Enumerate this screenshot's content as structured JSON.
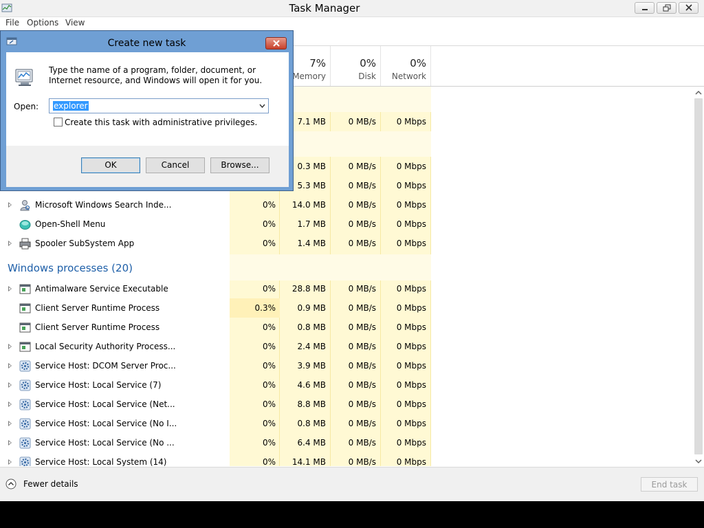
{
  "window": {
    "title": "Task Manager"
  },
  "menu": [
    "File",
    "Options",
    "View"
  ],
  "columns": {
    "memory": {
      "pct": "7%",
      "label": "Memory"
    },
    "disk": {
      "pct": "0%",
      "label": "Disk"
    },
    "network": {
      "pct": "0%",
      "label": "Network"
    }
  },
  "partial_rows": [
    {
      "memory": "7.1 MB",
      "disk": "0 MB/s",
      "network": "0 Mbps"
    },
    {
      "memory": "0.3 MB",
      "disk": "0 MB/s",
      "network": "0 Mbps"
    },
    {
      "memory": "5.3 MB",
      "disk": "0 MB/s",
      "network": "0 Mbps"
    }
  ],
  "background_rows": [
    {
      "name": "Microsoft Windows Search Inde...",
      "icon": "search-indexer-icon",
      "expandable": true,
      "cpu": "0%",
      "memory": "14.0 MB",
      "disk": "0 MB/s",
      "network": "0 Mbps"
    },
    {
      "name": "Open-Shell Menu",
      "icon": "shell-menu-icon",
      "expandable": false,
      "cpu": "0%",
      "memory": "1.7 MB",
      "disk": "0 MB/s",
      "network": "0 Mbps"
    },
    {
      "name": "Spooler SubSystem App",
      "icon": "printer-icon",
      "expandable": true,
      "cpu": "0%",
      "memory": "1.4 MB",
      "disk": "0 MB/s",
      "network": "0 Mbps"
    }
  ],
  "windows_group": {
    "label": "Windows processes (20)"
  },
  "windows_rows": [
    {
      "name": "Antimalware Service Executable",
      "icon": "process-window-icon",
      "expandable": true,
      "cpu": "0%",
      "memory": "28.8 MB",
      "disk": "0 MB/s",
      "network": "0 Mbps"
    },
    {
      "name": "Client Server Runtime Process",
      "icon": "process-window-icon",
      "expandable": false,
      "cpu": "0.3%",
      "memory": "0.9 MB",
      "disk": "0 MB/s",
      "network": "0 Mbps"
    },
    {
      "name": "Client Server Runtime Process",
      "icon": "process-window-icon",
      "expandable": false,
      "cpu": "0%",
      "memory": "0.8 MB",
      "disk": "0 MB/s",
      "network": "0 Mbps"
    },
    {
      "name": "Local Security Authority Process...",
      "icon": "process-window-icon",
      "expandable": true,
      "cpu": "0%",
      "memory": "2.4 MB",
      "disk": "0 MB/s",
      "network": "0 Mbps"
    },
    {
      "name": "Service Host: DCOM Server Proc...",
      "icon": "gear-icon",
      "expandable": true,
      "cpu": "0%",
      "memory": "3.9 MB",
      "disk": "0 MB/s",
      "network": "0 Mbps"
    },
    {
      "name": "Service Host: Local Service (7)",
      "icon": "gear-icon",
      "expandable": true,
      "cpu": "0%",
      "memory": "4.6 MB",
      "disk": "0 MB/s",
      "network": "0 Mbps"
    },
    {
      "name": "Service Host: Local Service (Net...",
      "icon": "gear-icon",
      "expandable": true,
      "cpu": "0%",
      "memory": "8.8 MB",
      "disk": "0 MB/s",
      "network": "0 Mbps"
    },
    {
      "name": "Service Host: Local Service (No I...",
      "icon": "gear-icon",
      "expandable": true,
      "cpu": "0%",
      "memory": "0.8 MB",
      "disk": "0 MB/s",
      "network": "0 Mbps"
    },
    {
      "name": "Service Host: Local Service (No ...",
      "icon": "gear-icon",
      "expandable": true,
      "cpu": "0%",
      "memory": "6.4 MB",
      "disk": "0 MB/s",
      "network": "0 Mbps"
    },
    {
      "name": "Service Host: Local System (14)",
      "icon": "gear-icon",
      "expandable": true,
      "cpu": "0%",
      "memory": "14.1 MB",
      "disk": "0 MB/s",
      "network": "0 Mbps"
    }
  ],
  "footer": {
    "fewer_details": "Fewer details",
    "end_task": "End task"
  },
  "dialog": {
    "title": "Create new task",
    "description": "Type the name of a program, folder, document, or Internet resource, and Windows will open it for you.",
    "open_label": "Open:",
    "open_value": "explorer",
    "admin_checkbox_label": "Create this task with administrative privileges.",
    "admin_checked": false,
    "ok": "OK",
    "cancel": "Cancel",
    "browse": "Browse..."
  },
  "colors": {
    "accent": "#1e5fa8",
    "heat_bg": "#fff9d4",
    "dialog_frame": "#6f9fd4"
  }
}
